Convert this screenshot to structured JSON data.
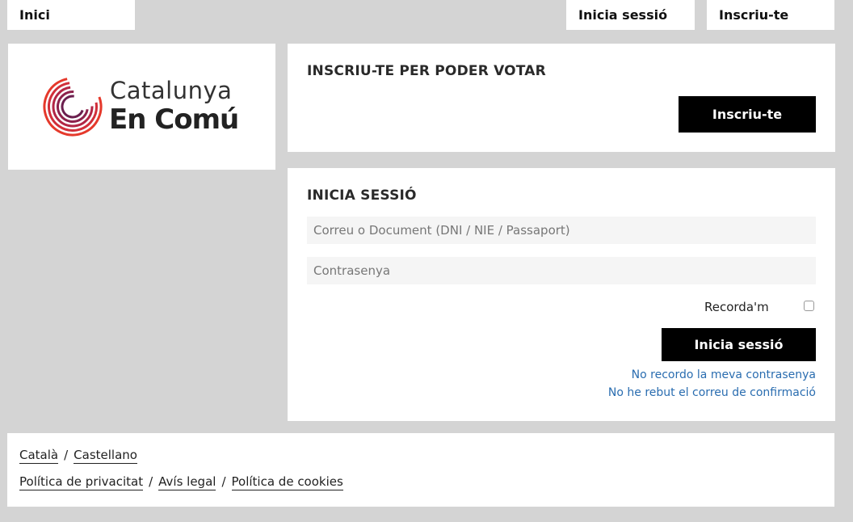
{
  "nav": {
    "home": "Inici",
    "login": "Inicia sessió",
    "register": "Inscriu-te"
  },
  "logo": {
    "line1": "Catalunya",
    "line2": "En Comú",
    "colors": [
      "#e5392b",
      "#a6224a",
      "#5a1e4e"
    ]
  },
  "register_panel": {
    "title": "INSCRIU-TE PER PODER VOTAR",
    "button": "Inscriu-te"
  },
  "login_panel": {
    "title": "INICIA SESSIÓ",
    "user_placeholder": "Correu o Document (DNI / NIE / Passaport)",
    "password_placeholder": "Contrasenya",
    "remember_label": "Recorda'm",
    "remember_checked": false,
    "submit": "Inicia sessió",
    "forgot_link": "No recordo la meva contrasenya",
    "confirm_link": "No he rebut el correu de confirmació"
  },
  "footer": {
    "languages": [
      "Català",
      "Castellano"
    ],
    "legal": [
      "Política de privacitat",
      "Avís legal",
      "Política de cookies"
    ],
    "separator": "/"
  }
}
